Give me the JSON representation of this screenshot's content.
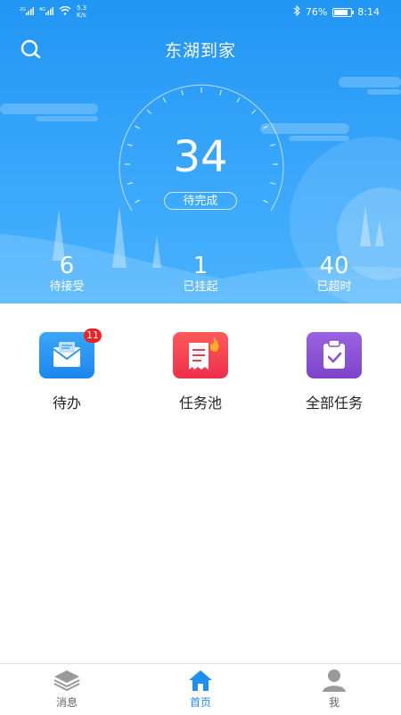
{
  "status_bar": {
    "speed_value": "5.3",
    "speed_unit": "K/s",
    "battery": "76%",
    "time": "8:14",
    "network_labels": [
      "2G",
      "4G"
    ]
  },
  "header": {
    "title": "东湖到家",
    "search_icon": "search-icon"
  },
  "gauge": {
    "count": "34",
    "label": "待完成"
  },
  "stats": [
    {
      "value": "6",
      "label": "待接受"
    },
    {
      "value": "1",
      "label": "已挂起"
    },
    {
      "value": "40",
      "label": "已超时"
    }
  ],
  "grid": [
    {
      "label": "待办",
      "icon": "mail-icon",
      "badge": "11",
      "color": "#1e8ef0"
    },
    {
      "label": "任务池",
      "icon": "receipt-fire-icon",
      "badge": "",
      "color": "#f0384a"
    },
    {
      "label": "全部任务",
      "icon": "clipboard-check-icon",
      "badge": "",
      "color": "#8b4fd4"
    }
  ],
  "tabbar": [
    {
      "label": "消息",
      "icon": "layers-icon",
      "active": false
    },
    {
      "label": "首页",
      "icon": "home-icon",
      "active": true
    },
    {
      "label": "我",
      "icon": "person-icon",
      "active": false
    }
  ],
  "colors": {
    "header_blue": "#2196f3",
    "accent": "#1e8ef0",
    "badge_red": "#ee2222"
  }
}
